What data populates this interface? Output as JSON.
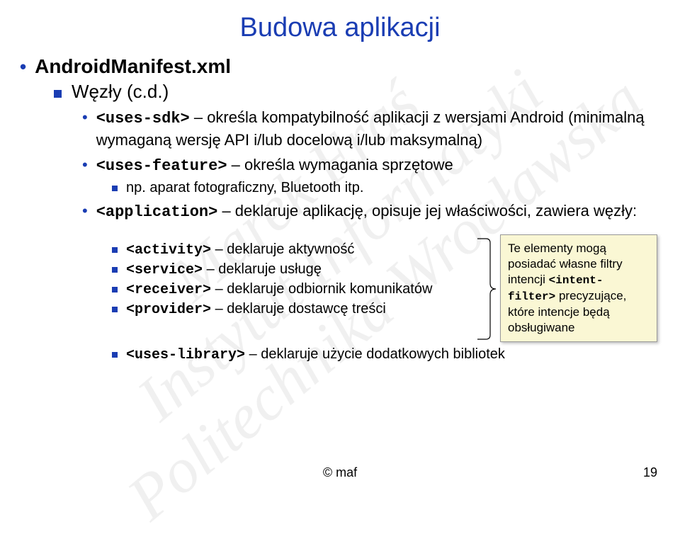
{
  "watermark": "Marek Fraś\nInstytut Informatyki\nPolitechnika Wrocławska",
  "title": "Budowa aplikacji",
  "heading1": "AndroidManifest.xml",
  "heading2": "Węzły (c.d.)",
  "items": {
    "uses_sdk": {
      "tag": "<uses-sdk>",
      "text": " – określa kompatybilność aplikacji z wersjami Android (minimalną wymaganą wersję API i/lub docelową i/lub maksymalną)"
    },
    "uses_feature": {
      "tag": "<uses-feature>",
      "text": " – określa wymagania sprzętowe"
    },
    "uses_feature_sub": "np. aparat fotograficzny, Bluetooth itp.",
    "application": {
      "tag": "<application>",
      "text": " – deklaruje aplikację, opisuje jej właściwości, zawiera węzły:"
    },
    "activity": {
      "tag": "<activity>",
      "text": " – deklaruje aktywność"
    },
    "service": {
      "tag": "<service>",
      "text": " – deklaruje usługę"
    },
    "receiver": {
      "tag": "<receiver>",
      "text": " – deklaruje odbiornik komunikatów"
    },
    "provider": {
      "tag": "<provider>",
      "text": " – deklaruje dostawcę treści"
    },
    "uses_library": {
      "tag": "<uses-library>",
      "text": " – deklaruje użycie dodatkowych bibliotek"
    }
  },
  "callout": {
    "line1": "Te elementy mogą posiadać własne filtry intencji",
    "tag": "<intent-filter>",
    "line2": "precyzujące, które intencje będą obsługiwane"
  },
  "footer": "© maf",
  "page": "19"
}
